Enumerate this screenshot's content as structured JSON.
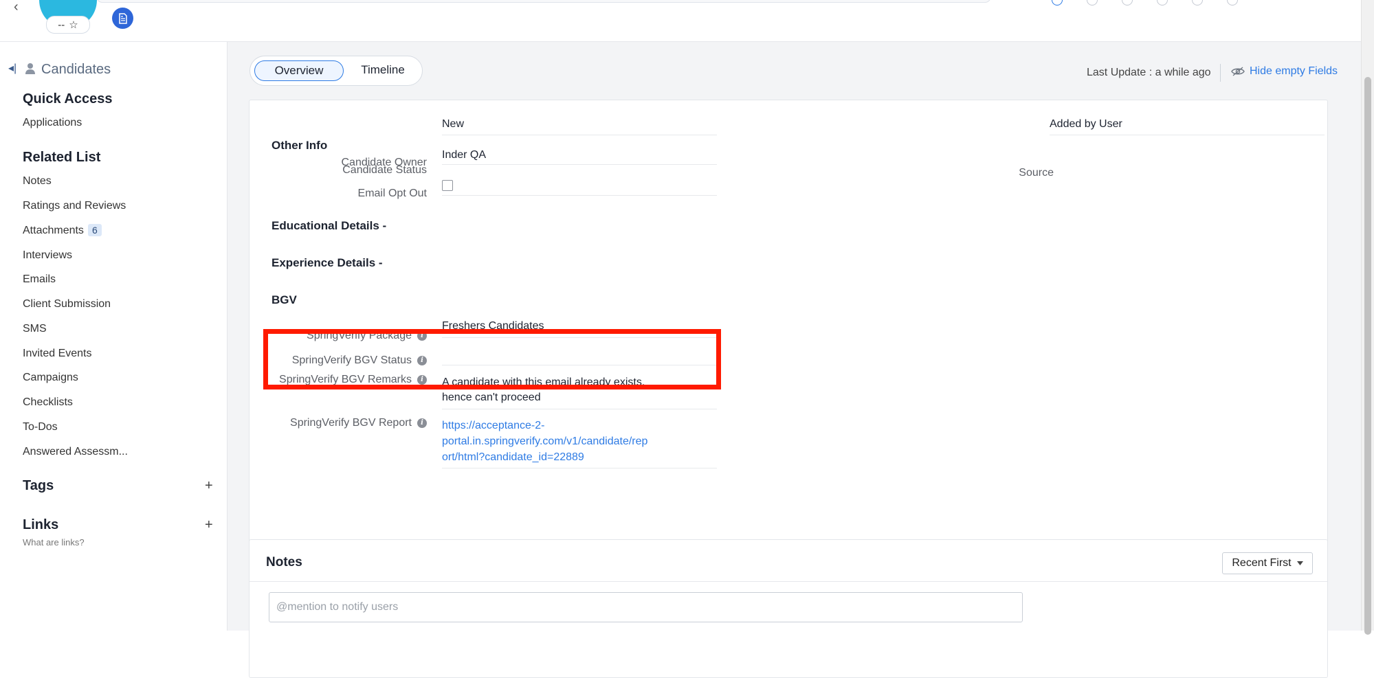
{
  "header": {
    "avatar_rating": "--",
    "star_glyph": "☆",
    "back_glyph": "‹"
  },
  "sidebar": {
    "back_glyph": "◂|",
    "title": "Candidates",
    "quick_access": {
      "heading": "Quick Access",
      "items": [
        "Applications"
      ]
    },
    "related_list": {
      "heading": "Related List",
      "items": [
        {
          "label": "Notes"
        },
        {
          "label": "Ratings and Reviews"
        },
        {
          "label": "Attachments",
          "badge": "6"
        },
        {
          "label": "Interviews"
        },
        {
          "label": "Emails"
        },
        {
          "label": "Client Submission"
        },
        {
          "label": "SMS"
        },
        {
          "label": "Invited Events"
        },
        {
          "label": "Campaigns"
        },
        {
          "label": "Checklists"
        },
        {
          "label": "To-Dos"
        },
        {
          "label": "Answered Assessm..."
        }
      ]
    },
    "tags": {
      "heading": "Tags",
      "add": "+"
    },
    "links": {
      "heading": "Links",
      "add": "+",
      "help": "What are links?"
    }
  },
  "main": {
    "tabs": [
      {
        "label": "Overview",
        "active": true
      },
      {
        "label": "Timeline",
        "active": false
      }
    ],
    "last_update": "Last Update : a while ago",
    "hide_empty": "Hide empty Fields",
    "other_info": {
      "heading": "Other Info",
      "fields": {
        "candidate_status": {
          "label": "Candidate Status",
          "value": "New"
        },
        "candidate_owner": {
          "label": "Candidate Owner",
          "value": "Inder QA"
        },
        "email_opt_out": {
          "label": "Email Opt Out",
          "checked": false
        },
        "source": {
          "label": "Source",
          "value": "Added by User"
        }
      }
    },
    "educational_heading": "Educational Details -",
    "experience_heading": "Experience Details -",
    "bgv": {
      "heading": "BGV",
      "package": {
        "label": "SpringVerify Package",
        "value": "Freshers Candidates"
      },
      "status": {
        "label": "SpringVerify BGV Status",
        "value": ""
      },
      "remarks": {
        "label": "SpringVerify BGV Remarks",
        "value_line1": "A candidate with this email already exists,",
        "value_line2": "hence can't proceed"
      },
      "report": {
        "label": "SpringVerify BGV Report",
        "line1": "https://acceptance-2-",
        "line2": "portal.in.springverify.com/v1/candidate/rep",
        "line3": "ort/html?candidate_id=22889"
      }
    }
  },
  "notes": {
    "title": "Notes",
    "sort_label": "Recent First",
    "input_placeholder": "@mention to notify users"
  },
  "colors": {
    "accent": "#2e7be4",
    "highlight": "#ff1a00",
    "avatar": "#2bb8e0"
  }
}
